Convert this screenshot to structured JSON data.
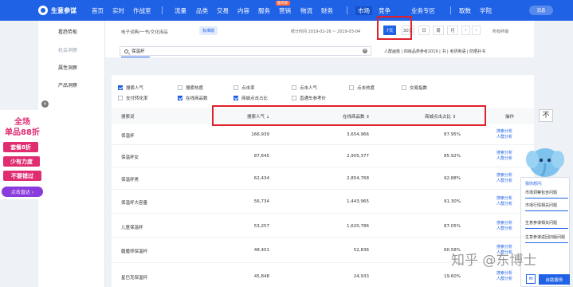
{
  "brand": {
    "name": "生意参谋"
  },
  "nav": {
    "items": [
      "首页",
      "实时",
      "作战室",
      "流量",
      "品类",
      "交易",
      "内容",
      "服务",
      "营销",
      "物流",
      "财务",
      "市场",
      "竞争",
      "业务专区",
      "取数",
      "学院"
    ],
    "active": "市场",
    "hot_badge": "服务新",
    "message": "消息"
  },
  "sidebar": {
    "items": [
      {
        "label": "看趋势板"
      },
      {
        "label": "机会洞察"
      },
      {
        "label": "属性洞察"
      },
      {
        "label": "产品洞察"
      }
    ]
  },
  "ad": {
    "line1": "全场",
    "line2": "单品88折",
    "pills": [
      "套餐8折",
      "少有力度",
      "不要错过"
    ],
    "cta": "点击直达 ›"
  },
  "filter": {
    "breadcrumb": "电子词典/一书/文化用品",
    "tag": "标准版",
    "stat_time": "统计时间 2019-02-26 ~ 2019-03-04",
    "periods": [
      "7天",
      "30天",
      "日",
      "周",
      "月"
    ],
    "active_period": "7天",
    "all_terms": "所有终端",
    "search_value": "保温杯",
    "related": "人群画像 | 四级品类参考2019 | 书 | 考研英语 | 防晒补书"
  },
  "metrics": {
    "row1": [
      {
        "label": "搜索人气",
        "checked": true
      },
      {
        "label": "搜索热度",
        "checked": false
      },
      {
        "label": "点击率",
        "checked": false
      },
      {
        "label": "点击人气",
        "checked": false
      },
      {
        "label": "点击热度",
        "checked": false
      },
      {
        "label": "交易指数",
        "checked": false
      }
    ],
    "row2": [
      {
        "label": "支付转化率",
        "checked": false
      },
      {
        "label": "在线商品数",
        "checked": true
      },
      {
        "label": "商城点击占比",
        "checked": true
      },
      {
        "label": "直通车参考价",
        "checked": false
      }
    ]
  },
  "table": {
    "columns": [
      "搜索词",
      "搜索人气 ⇣",
      "在线商品数 ⇕",
      "商城点击占比 ⇕",
      "操作"
    ],
    "op_labels": [
      "搜索分析",
      "人群分析"
    ],
    "rows": [
      {
        "term": "保温杯",
        "popularity": "166,939",
        "online": "3,654,966",
        "ratio": "87.95%"
      },
      {
        "term": "保温杯女",
        "popularity": "87,645",
        "online": "2,905,377",
        "ratio": "85.92%"
      },
      {
        "term": "保温杯男",
        "popularity": "62,434",
        "online": "2,854,768",
        "ratio": "92.88%"
      },
      {
        "term": "保温杯大容量",
        "popularity": "56,734",
        "online": "1,443,965",
        "ratio": "91.30%"
      },
      {
        "term": "儿童保温杯",
        "popularity": "53,257",
        "online": "1,620,786",
        "ratio": "87.05%"
      },
      {
        "term": "膳魔师保温杯",
        "popularity": "48,401",
        "online": "52,836",
        "ratio": "60.58%"
      },
      {
        "term": "星巴克保温杯",
        "popularity": "45,848",
        "online": "24,933",
        "ratio": "19.60%"
      }
    ]
  },
  "side_tools": {
    "top_button": "不",
    "panel_title": "猜你想问:",
    "panel_items": [
      "市场洞察包含问题",
      "市场行情相关问题",
      "生意参谋相关问题",
      "生意参谋返回旧版问题"
    ],
    "help_label": "自助服务"
  },
  "watermark": "知乎 @东博士"
}
